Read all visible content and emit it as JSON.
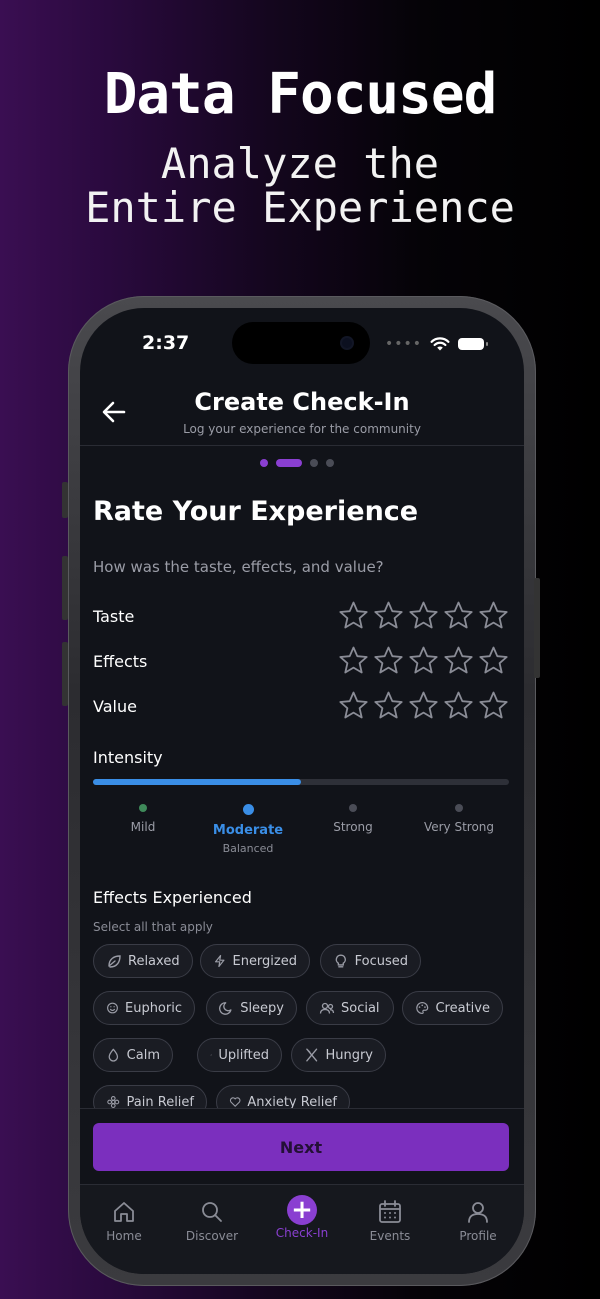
{
  "hero": {
    "title": "Data Focused",
    "subtitle_line1": "Analyze the",
    "subtitle_line2": "Entire Experience"
  },
  "status_bar": {
    "time": "2:37"
  },
  "header": {
    "title": "Create Check-In",
    "subtitle": "Log your experience for the community"
  },
  "progress": {
    "steps_total": 4,
    "current_step": 2
  },
  "rating": {
    "heading": "Rate Your Experience",
    "question": "How was the taste, effects, and value?",
    "rows": [
      {
        "label": "Taste",
        "stars": 0,
        "max": 5
      },
      {
        "label": "Effects",
        "stars": 0,
        "max": 5
      },
      {
        "label": "Value",
        "stars": 0,
        "max": 5
      }
    ]
  },
  "intensity": {
    "label": "Intensity",
    "value_fraction": 0.5,
    "levels": [
      {
        "label": "Mild"
      },
      {
        "label": "Moderate",
        "sub": "Balanced",
        "selected": true
      },
      {
        "label": "Strong"
      },
      {
        "label": "Very Strong"
      }
    ]
  },
  "effects": {
    "heading": "Effects Experienced",
    "hint": "Select all that apply",
    "chips": [
      {
        "label": "Relaxed",
        "icon": "leaf-icon"
      },
      {
        "label": "Energized",
        "icon": "bolt-icon"
      },
      {
        "label": "Focused",
        "icon": "bulb-icon"
      },
      {
        "label": "Euphoric",
        "icon": "smile-icon"
      },
      {
        "label": "Sleepy",
        "icon": "moon-icon"
      },
      {
        "label": "Social",
        "icon": "users-icon"
      },
      {
        "label": "Creative",
        "icon": "palette-icon"
      },
      {
        "label": "Calm",
        "icon": "drop-icon"
      },
      {
        "label": "Uplifted",
        "icon": "trend-up-icon"
      },
      {
        "label": "Hungry",
        "icon": "utensils-icon"
      },
      {
        "label": "Pain Relief",
        "icon": "flower-icon"
      },
      {
        "label": "Anxiety Relief",
        "icon": "heart-icon"
      }
    ]
  },
  "actions": {
    "next_label": "Next"
  },
  "tabbar": {
    "home": "Home",
    "discover": "Discover",
    "checkin": "Check-In",
    "events": "Events",
    "profile": "Profile"
  },
  "colors": {
    "accent": "#8a3fd1",
    "slider": "#3a8ee6",
    "background": "#111319"
  }
}
